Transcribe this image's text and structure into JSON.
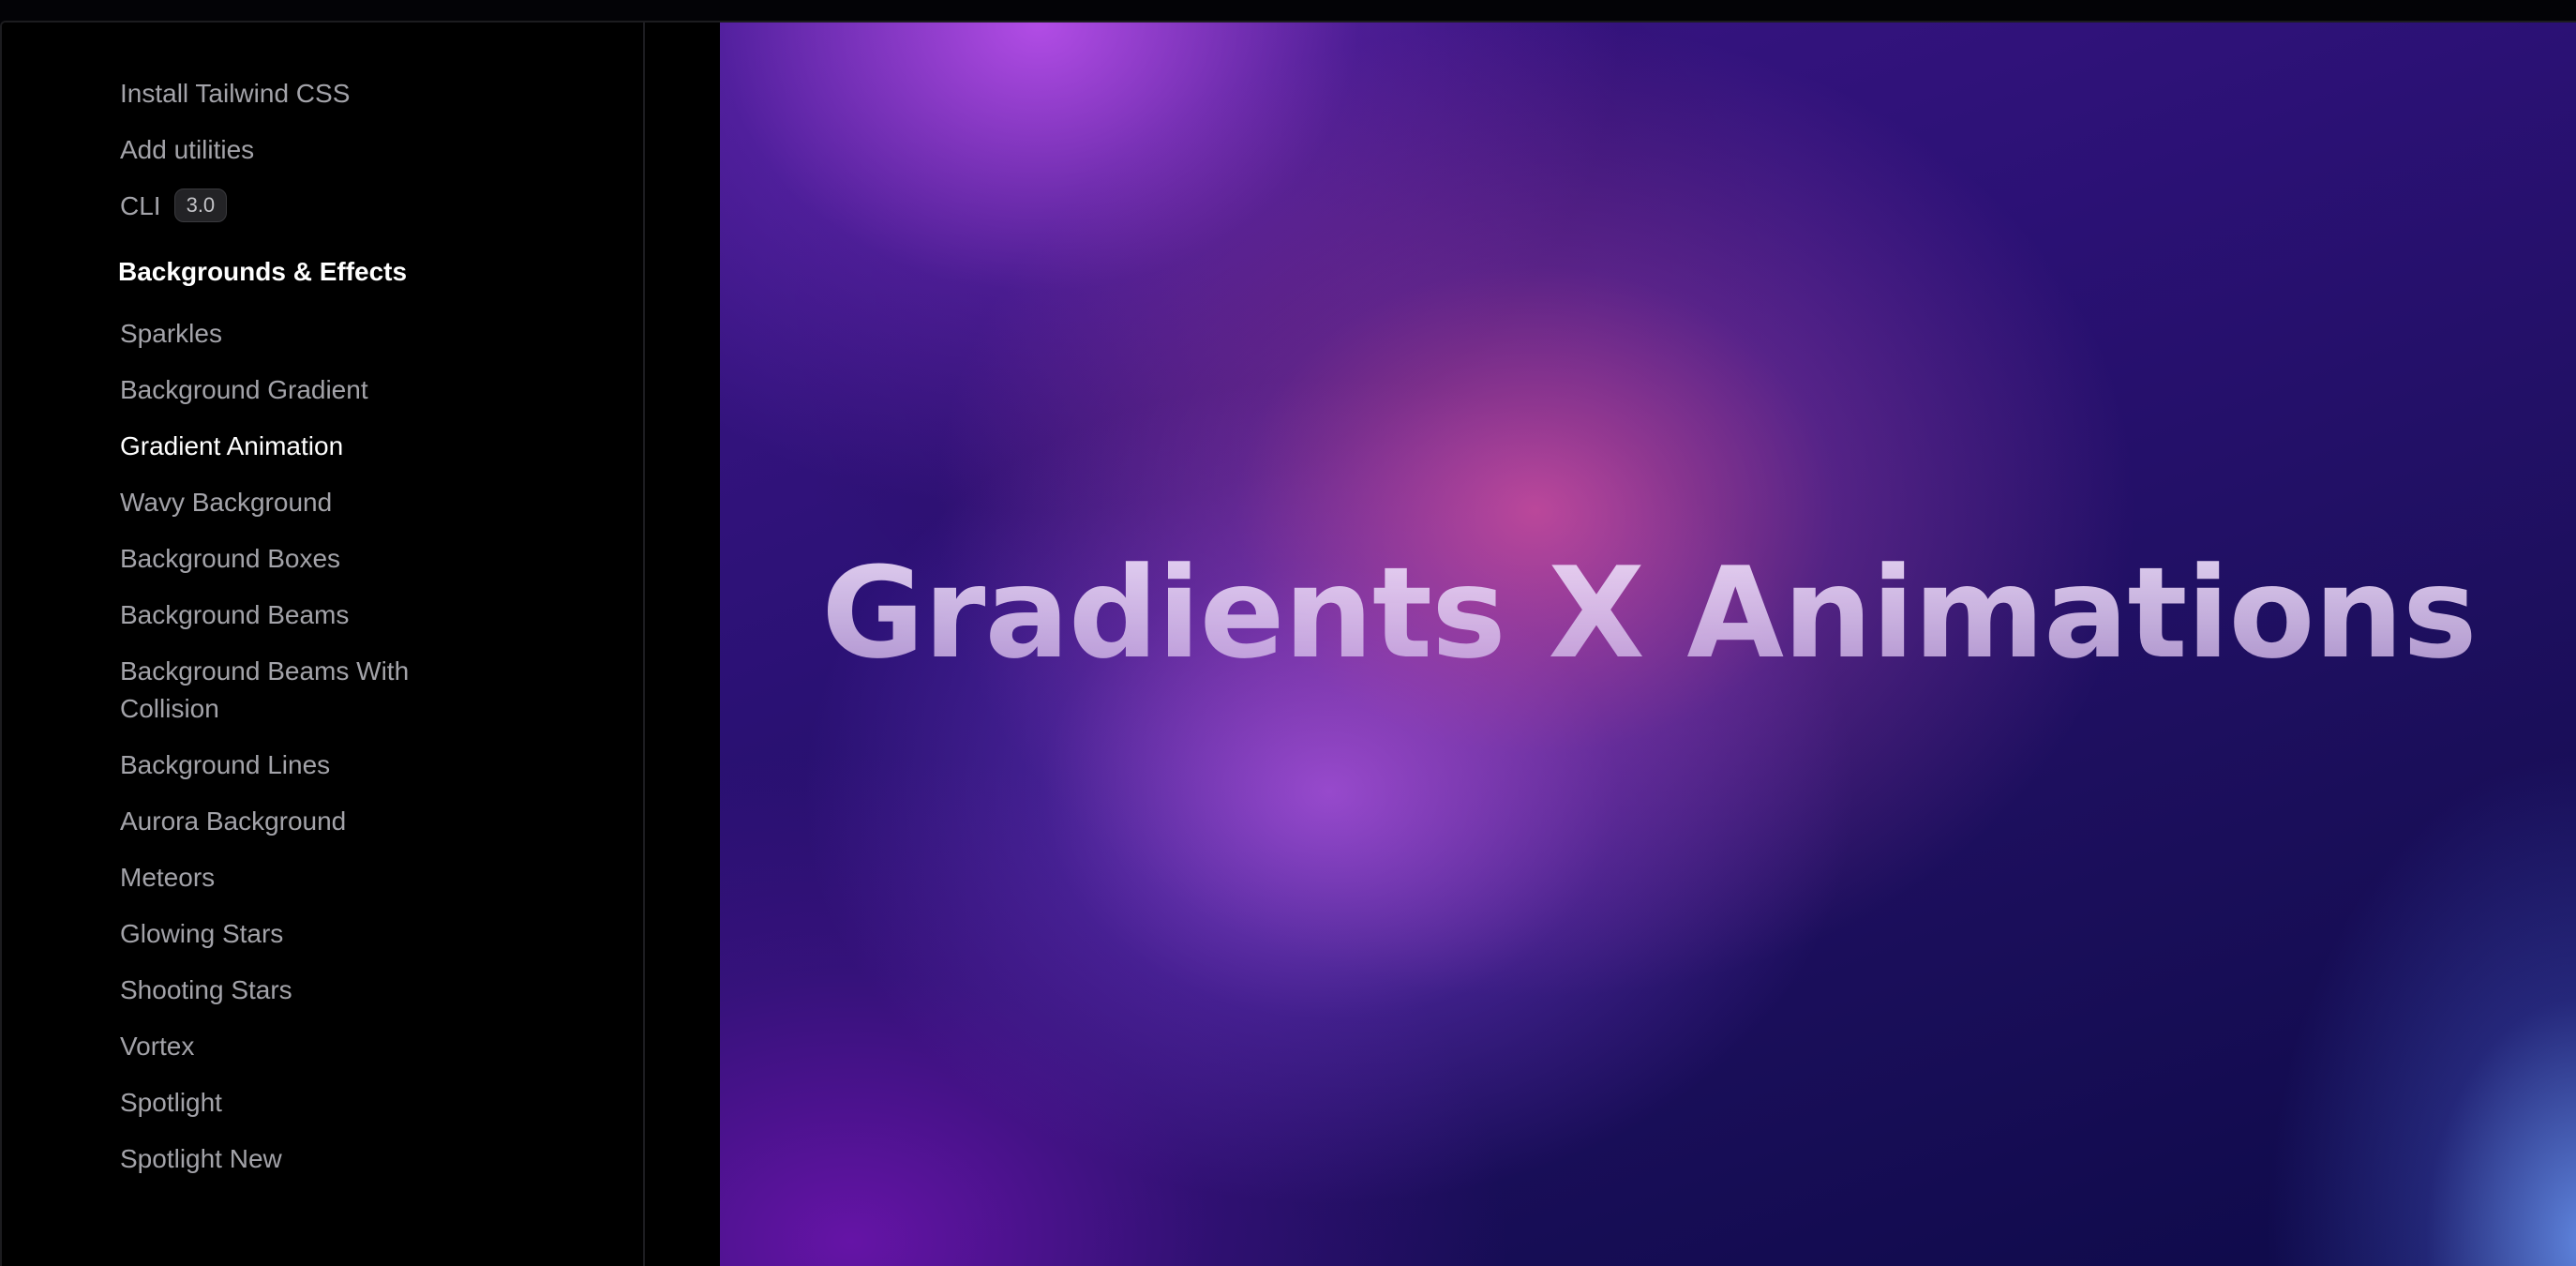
{
  "sidebar": {
    "top_items": [
      {
        "label": "Install Tailwind CSS"
      },
      {
        "label": "Add utilities"
      },
      {
        "label": "CLI",
        "badge": "3.0"
      }
    ],
    "section": {
      "heading": "Backgrounds & Effects",
      "items": [
        {
          "label": "Sparkles"
        },
        {
          "label": "Background Gradient"
        },
        {
          "label": "Gradient Animation",
          "active": true
        },
        {
          "label": "Wavy Background"
        },
        {
          "label": "Background Boxes"
        },
        {
          "label": "Background Beams"
        },
        {
          "label": "Background Beams With Collision"
        },
        {
          "label": "Background Lines"
        },
        {
          "label": "Aurora Background"
        },
        {
          "label": "Meteors"
        },
        {
          "label": "Glowing Stars"
        },
        {
          "label": "Shooting Stars"
        },
        {
          "label": "Vortex"
        },
        {
          "label": "Spotlight"
        },
        {
          "label": "Spotlight New"
        }
      ]
    }
  },
  "preview": {
    "title": "Gradients X Animations"
  },
  "colors": {
    "sidebar_bg": "#000000",
    "nav_text": "#a3a3a9",
    "nav_active": "#ffffff",
    "gradient_purple": "#3e1688",
    "gradient_pink": "#d250a0",
    "gradient_blue": "#648ce6"
  }
}
